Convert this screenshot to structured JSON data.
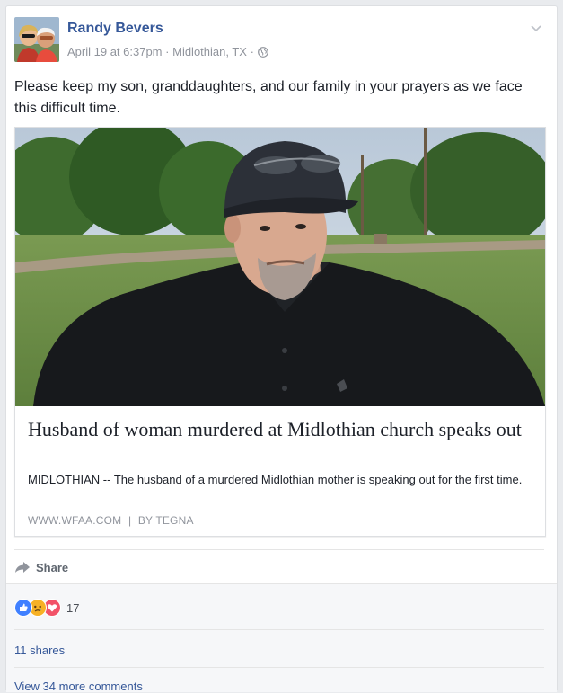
{
  "post": {
    "author": "Randy Bevers",
    "timestamp": "April 19 at 6:37pm",
    "location": "Midlothian, TX",
    "separator": "·",
    "audience_icon": "globe-icon",
    "options_icon": "chevron-down-icon",
    "text": "Please keep my son, granddaughters, and our family in your prayers as we face this difficult time."
  },
  "link": {
    "title": "Husband of woman murdered at Midlothian church speaks out",
    "description": "MIDLOTHIAN -- The husband of a murdered Midlothian mother is speaking out for the first time.",
    "domain": "WWW.WFAA.COM",
    "divider": "|",
    "byline": "BY TEGNA"
  },
  "actions": {
    "share_label": "Share",
    "share_icon": "share-arrow-icon"
  },
  "footer": {
    "reaction_icons": [
      "like-icon",
      "sad-icon",
      "love-icon"
    ],
    "reaction_count": "17",
    "shares": "11 shares",
    "more_comments": "View 34 more comments"
  },
  "colors": {
    "link_blue": "#365899",
    "meta_gray": "#90949c",
    "like": "#4080ff",
    "sad": "#f7b125",
    "love": "#f25268"
  }
}
